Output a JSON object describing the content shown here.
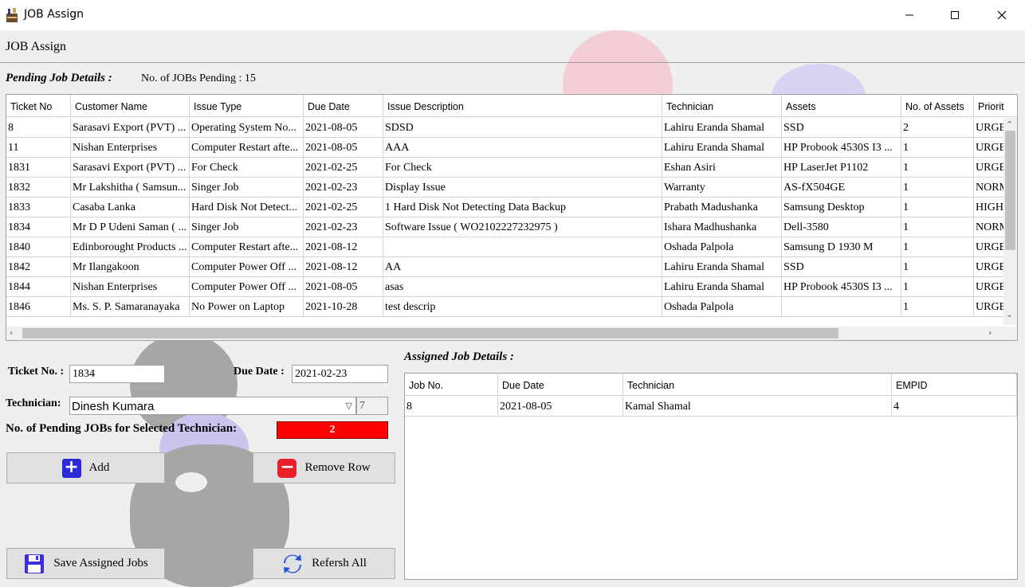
{
  "window": {
    "title": "JOB Assign"
  },
  "form_title": "JOB Assign",
  "pending": {
    "title": "Pending Job Details :",
    "count_text": "No. of JOBs Pending : 15",
    "columns": [
      "Ticket No",
      "Customer Name",
      "Issue Type",
      "Due Date",
      "Issue Description",
      "Technician",
      "Assets",
      "No. of Assets",
      "Priorit"
    ],
    "rows": [
      [
        "8",
        "Sarasavi Export (PVT) ...",
        "Operating System No...",
        "2021-08-05",
        "SDSD",
        "Lahiru Eranda Shamal",
        "SSD",
        "2",
        "URGE"
      ],
      [
        "11",
        "Nishan Enterprises",
        "Computer Restart afte...",
        "2021-08-05",
        "AAA",
        "Lahiru Eranda Shamal",
        "HP Probook 4530S I3 ...",
        "1",
        "URGE"
      ],
      [
        "1831",
        "Sarasavi Export (PVT) ...",
        "For Check",
        "2021-02-25",
        "For Check",
        "Eshan Asiri",
        "HP LaserJet P1102",
        "1",
        "URGE"
      ],
      [
        "1832",
        "Mr Lakshitha ( Samsun...",
        "Singer Job",
        "2021-02-23",
        "Display Issue",
        "Warranty",
        "AS-fX504GE",
        "1",
        "NORM"
      ],
      [
        "1833",
        "Casaba Lanka",
        "Hard Disk Not Detect...",
        "2021-02-25",
        "1 Hard Disk Not Detecting Data Backup",
        "Prabath Madushanka",
        "Samsung Desktop",
        "1",
        "HIGH"
      ],
      [
        "1834",
        "Mr D P Udeni Saman ( ...",
        "Singer Job",
        "2021-02-23",
        "Software Issue ( WO2102227232975 )",
        "Ishara Madhushanka",
        "Dell-3580",
        "1",
        "NORM"
      ],
      [
        "1840",
        "Edinborought Products ...",
        "Computer Restart afte...",
        "2021-08-12",
        "",
        "Oshada Palpola",
        "Samsung D 1930 M",
        "1",
        "URGE"
      ],
      [
        "1842",
        "Mr Ilangakoon",
        "Computer Power Off ...",
        "2021-08-12",
        "AA",
        "Lahiru Eranda Shamal",
        "SSD",
        "1",
        "URGE"
      ],
      [
        "1844",
        "Nishan Enterprises",
        "Computer Power Off ...",
        "2021-08-05",
        "asas",
        "Lahiru Eranda Shamal",
        "HP Probook 4530S I3 ...",
        "1",
        "URGE"
      ],
      [
        "1846",
        "Ms. S. P. Samaranayaka",
        "No Power on Laptop",
        "2021-10-28",
        "test descrip",
        "Oshada Palpola",
        "",
        "1",
        "URGE"
      ]
    ]
  },
  "form": {
    "ticket_label": "Ticket No. :",
    "ticket_value": "1834",
    "due_label": "Due  Date :",
    "due_value": "2021-02-23",
    "technician_label": "Technician:",
    "technician_value": "Dinesh Kumara",
    "technician_id": "7",
    "pending_label": "No. of Pending JOBs for Selected Technician:",
    "pending_value": "2"
  },
  "buttons": {
    "add": "Add",
    "remove": "Remove Row",
    "save": "Save Assigned Jobs",
    "refresh": "Refersh All"
  },
  "assigned": {
    "title": "Assigned Job Details :",
    "columns": [
      "Job No.",
      "Due Date",
      "Technician",
      "EMPID"
    ],
    "rows": [
      [
        "8",
        "2021-08-05",
        "Kamal Shamal",
        "4"
      ]
    ]
  },
  "colors": {
    "pending_badge": "#ff0000",
    "add_icon": "#2a2ad8",
    "remove_icon": "#e8202a",
    "save_icon": "#3a2ee0",
    "refresh_icon": "#2050e0"
  },
  "icons": {
    "app": "wrench-icon",
    "minimize": "minimize-icon",
    "maximize": "maximize-icon",
    "close": "close-icon",
    "add": "plus-icon",
    "remove": "minus-icon",
    "save": "floppy-disk-icon",
    "refresh": "refresh-arrows-icon"
  }
}
